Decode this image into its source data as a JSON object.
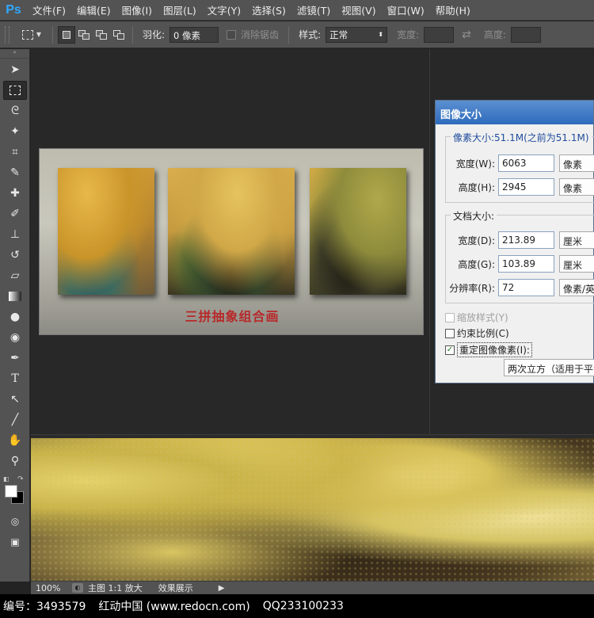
{
  "app": {
    "logo": "Ps"
  },
  "menu": [
    "文件(F)",
    "编辑(E)",
    "图像(I)",
    "图层(L)",
    "文字(Y)",
    "选择(S)",
    "滤镜(T)",
    "视图(V)",
    "窗口(W)",
    "帮助(H)"
  ],
  "options": {
    "feather_label": "羽化:",
    "feather_value": "0 像素",
    "antialias_label": "消除锯齿",
    "style_label": "样式:",
    "style_value": "正常",
    "width_label": "宽度:",
    "height_label": "高度:"
  },
  "tools": [
    "move-tool",
    "marquee-tool",
    "lasso-tool",
    "magic-wand-tool",
    "crop-tool",
    "eyedropper-tool",
    "healing-brush-tool",
    "brush-tool",
    "clone-stamp-tool",
    "history-brush-tool",
    "eraser-tool",
    "gradient-tool",
    "blur-tool",
    "dodge-tool",
    "pen-tool",
    "type-tool",
    "path-selection-tool",
    "line-tool",
    "hand-tool",
    "zoom-tool"
  ],
  "artwork": {
    "caption": "三拼抽象组合画"
  },
  "dialog": {
    "title": "图像大小",
    "pixel_group_title": "像素大小:51.1M(之前为51.1M)",
    "pixel_width_label": "宽度(W):",
    "pixel_width_value": "6063",
    "pixel_width_unit": "像素",
    "pixel_height_label": "高度(H):",
    "pixel_height_value": "2945",
    "pixel_height_unit": "像素",
    "doc_group_title": "文档大小:",
    "doc_width_label": "宽度(D):",
    "doc_width_value": "213.89",
    "doc_width_unit": "厘米",
    "doc_height_label": "高度(G):",
    "doc_height_value": "103.89",
    "doc_height_unit": "厘米",
    "resolution_label": "分辨率(R):",
    "resolution_value": "72",
    "resolution_unit": "像素/英寸",
    "scale_styles_label": "缩放样式(Y)",
    "constrain_label": "约束比例(C)",
    "resample_label": "重定图像像素(I):",
    "resample_value": "两次立方（适用于平滑渐变）"
  },
  "status": {
    "zoom": "100%",
    "doc_info": "主图 1:1 放大",
    "effect": "效果展示"
  },
  "watermark": {
    "id": "编号：3493579",
    "site": "红动中国 (www.redocn.com)",
    "qq": "QQ233100233"
  }
}
